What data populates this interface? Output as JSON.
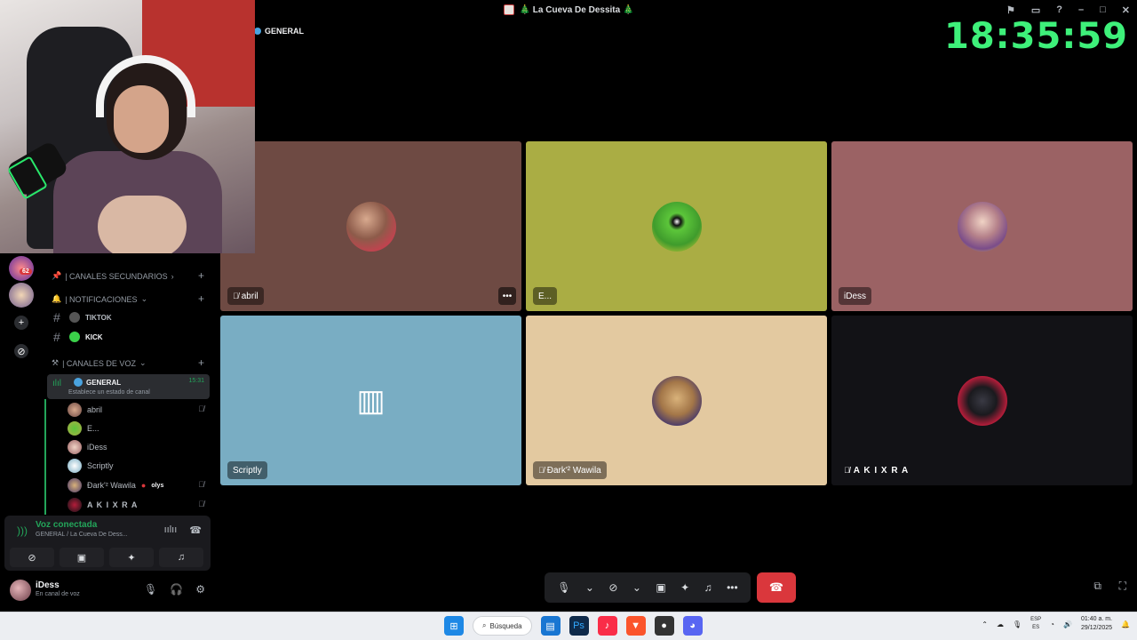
{
  "window": {
    "title": "🎄 La Cueva De Dessita 🎄"
  },
  "clock_overlay": "18:35:59",
  "channel_header": "GENERAL",
  "sidebar": {
    "server_badge": "62",
    "categories": [
      {
        "label": "| CANALES SECUNDARIOS"
      },
      {
        "label": "| NOTIFICACIONES"
      },
      {
        "label": "| CANALES DE VOZ"
      }
    ],
    "channels": [
      {
        "name": "TIKTOK"
      },
      {
        "name": "KICK"
      }
    ],
    "voice_channel": {
      "name": "GENERAL",
      "time": "15:31",
      "status": "Establece un estado de canal"
    },
    "voice_users": [
      {
        "name": "abril",
        "tag": ""
      },
      {
        "name": "E...",
        "tag": ""
      },
      {
        "name": "iDess",
        "tag": ""
      },
      {
        "name": "Scriptly",
        "tag": ""
      },
      {
        "name": "Ðark'² Wawila",
        "tag": "olys"
      },
      {
        "name": "A K I X R A",
        "tag": ""
      }
    ]
  },
  "voice_panel": {
    "title": "Voz conectada",
    "subtitle": "GENERAL / La Cueva De Dess..."
  },
  "user_panel": {
    "username": "iDess",
    "status": "En canal de voz"
  },
  "tiles": [
    {
      "label": "abril",
      "color": "#6e4a43"
    },
    {
      "label": "E...",
      "color": "#aaad44"
    },
    {
      "label": "iDess",
      "color": "#9b6264"
    },
    {
      "label": "Scriptly",
      "color": "#79adc3"
    },
    {
      "label": "Ðark'² Wawila",
      "color": "#e3c9a0"
    },
    {
      "label": "A K I X R A",
      "color": "#121216"
    }
  ],
  "taskbar": {
    "search_label": "Búsqueda",
    "lang_top": "ESP",
    "lang_bottom": "ES",
    "time": "01:40 a. m.",
    "date": "29/12/2025"
  }
}
